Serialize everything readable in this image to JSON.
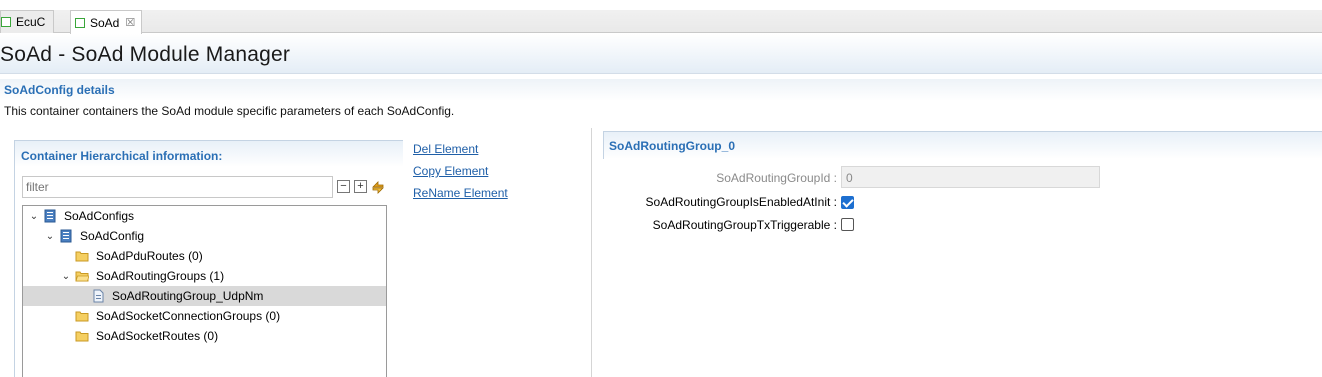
{
  "tabs": [
    {
      "label": "EcuC",
      "active": false
    },
    {
      "label": "SoAd",
      "active": true,
      "close": "☒"
    }
  ],
  "header": {
    "title": "SoAd - SoAd Module Manager"
  },
  "section": {
    "title": "SoAdConfig details",
    "description": "This container containers the SoAd module specific parameters of each SoAdConfig."
  },
  "left_panel": {
    "title": "Container Hierarchical information:",
    "filter_placeholder": "filter",
    "collapse_all": "−",
    "expand_all": "+",
    "tree": [
      {
        "label": "SoAdConfigs",
        "icon": "module-icon",
        "expanded": true
      },
      {
        "label": "SoAdConfig",
        "icon": "module-icon",
        "expanded": true
      },
      {
        "label": "SoAdPduRoutes (0)",
        "icon": "folder-icon",
        "expanded": false
      },
      {
        "label": "SoAdRoutingGroups (1)",
        "icon": "folder-icon",
        "expanded": true
      },
      {
        "label": "SoAdRoutingGroup_UdpNm",
        "icon": "file-icon",
        "selected": true
      },
      {
        "label": "SoAdSocketConnectionGroups (0)",
        "icon": "folder-icon",
        "expanded": false
      },
      {
        "label": "SoAdSocketRoutes (0)",
        "icon": "folder-icon",
        "expanded": false
      }
    ]
  },
  "actions": {
    "del": "Del Element",
    "copy": "Copy Element",
    "rename": "ReName Element"
  },
  "right_panel": {
    "title": "SoAdRoutingGroup_0",
    "fields": [
      {
        "label": "SoAdRoutingGroupId :",
        "value": "0",
        "type": "text",
        "disabled": true
      },
      {
        "label": "SoAdRoutingGroupIsEnabledAtInit :",
        "type": "checkbox",
        "checked": true
      },
      {
        "label": "SoAdRoutingGroupTxTriggerable :",
        "type": "checkbox",
        "checked": false
      }
    ]
  },
  "colors": {
    "accent": "#2a6fb5",
    "link": "#1f5fa8",
    "checkbox": "#1d6fd0",
    "selection": "#d9d9d9"
  }
}
